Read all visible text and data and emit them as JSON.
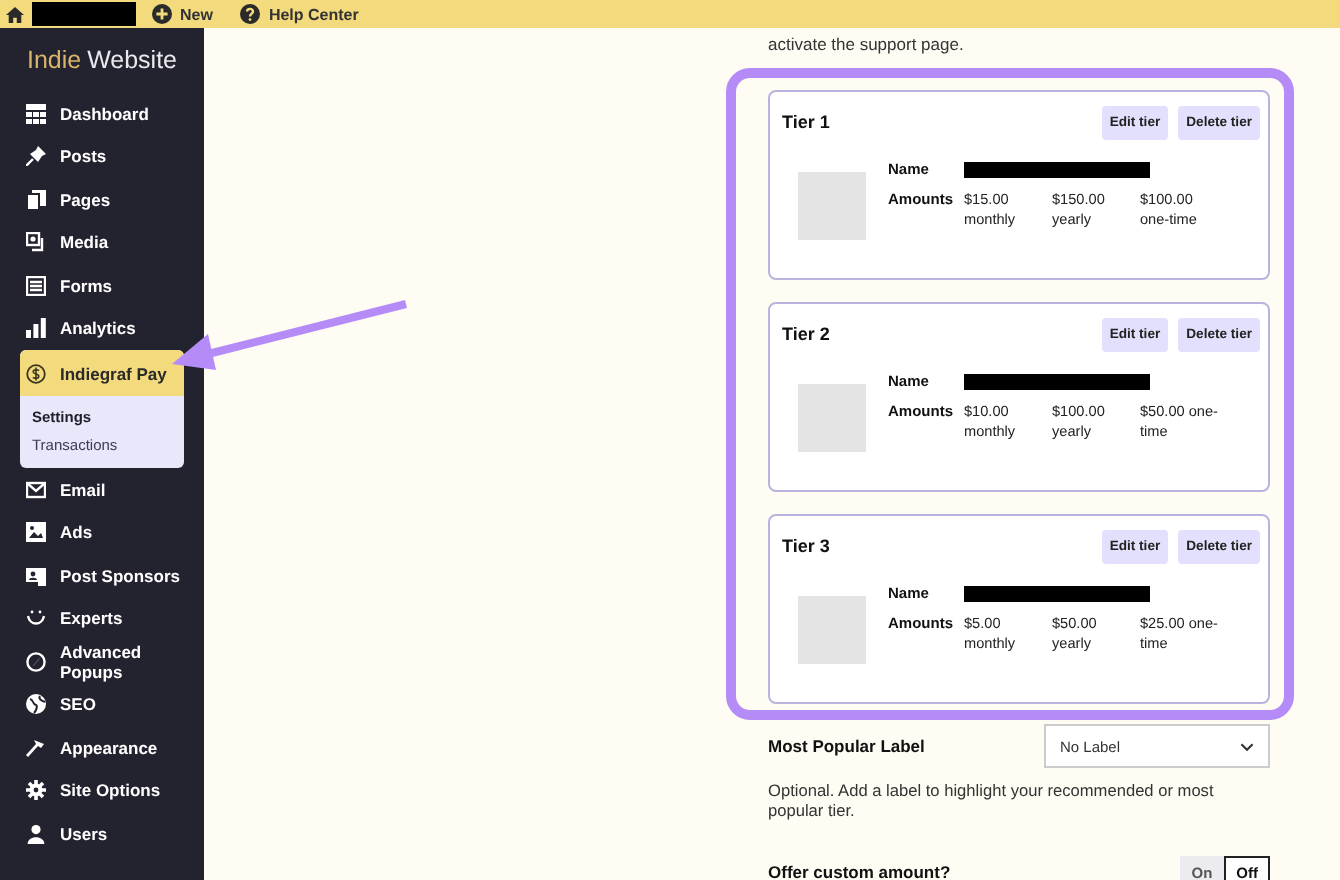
{
  "top_bar": {
    "items": [
      {
        "label": "New"
      },
      {
        "label": "Help Center"
      }
    ]
  },
  "sidebar": {
    "brand_accent": "Indie",
    "brand_name": "Website",
    "items": [
      {
        "label": "Dashboard",
        "selected": false
      },
      {
        "label": "Posts",
        "selected": false
      },
      {
        "label": "Pages",
        "selected": false
      },
      {
        "label": "Media",
        "selected": false
      },
      {
        "label": "Forms",
        "selected": false
      },
      {
        "label": "Analytics",
        "selected": false
      },
      {
        "label": "Indiegraf Pay",
        "selected": true,
        "children": [
          {
            "label": "Settings",
            "selected": true
          },
          {
            "label": "Transactions",
            "selected": false
          }
        ]
      },
      {
        "label": "Email",
        "selected": false
      },
      {
        "label": "Ads",
        "selected": false
      },
      {
        "label": "Post Sponsors",
        "selected": false
      },
      {
        "label": "Experts",
        "selected": false
      },
      {
        "label": "Advanced Popups",
        "selected": false
      },
      {
        "label": "SEO",
        "selected": false
      },
      {
        "label": "Appearance",
        "selected": false
      },
      {
        "label": "Site Options",
        "selected": false
      },
      {
        "label": "Users",
        "selected": false
      }
    ]
  },
  "intro": "activate the support page.",
  "tiers": [
    {
      "title": "Tier 1",
      "buttons": [
        "Edit tier",
        "Delete tier"
      ],
      "name_label": "Name",
      "amounts_label": "Amounts",
      "amounts": [
        "$15.00 monthly",
        "$150.00 yearly",
        "$100.00 one-time"
      ]
    },
    {
      "title": "Tier 2",
      "buttons": [
        "Edit tier",
        "Delete tier"
      ],
      "name_label": "Name",
      "amounts_label": "Amounts",
      "amounts": [
        "$10.00 monthly",
        "$100.00 yearly",
        "$50.00 one-time"
      ]
    },
    {
      "title": "Tier 3",
      "buttons": [
        "Edit tier",
        "Delete tier"
      ],
      "name_label": "Name",
      "amounts_label": "Amounts",
      "amounts": [
        "$5.00 monthly",
        "$50.00 yearly",
        "$25.00 one-time"
      ]
    }
  ],
  "most_popular": {
    "label": "Most Popular Label",
    "value": "No Label",
    "help": "Optional. Add a label to highlight your recommended or most popular tier."
  },
  "custom_amount": {
    "label": "Offer custom amount?",
    "options": [
      {
        "label": "On",
        "selected": false
      },
      {
        "label": "Off",
        "selected": true
      }
    ]
  }
}
